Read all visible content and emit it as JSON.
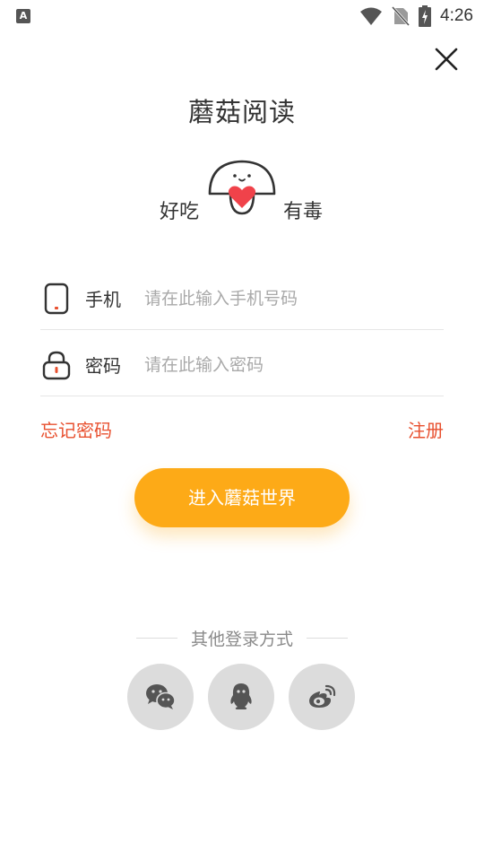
{
  "status_bar": {
    "time": "4:26",
    "notification_icon": "text-a-icon"
  },
  "app": {
    "title": "蘑菇阅读",
    "slogan_left": "好吃",
    "slogan_right": "有毒"
  },
  "form": {
    "phone": {
      "label": "手机",
      "placeholder": "请在此输入手机号码",
      "value": ""
    },
    "password": {
      "label": "密码",
      "placeholder": "请在此输入密码",
      "value": ""
    },
    "forgot": "忘记密码",
    "register": "注册",
    "submit": "进入蘑菇世界"
  },
  "other_login": {
    "label": "其他登录方式",
    "providers": [
      "wechat-icon",
      "qq-icon",
      "weibo-icon"
    ]
  },
  "colors": {
    "accent": "#fdaa17",
    "link": "#e8502f",
    "heart": "#f0424a"
  }
}
